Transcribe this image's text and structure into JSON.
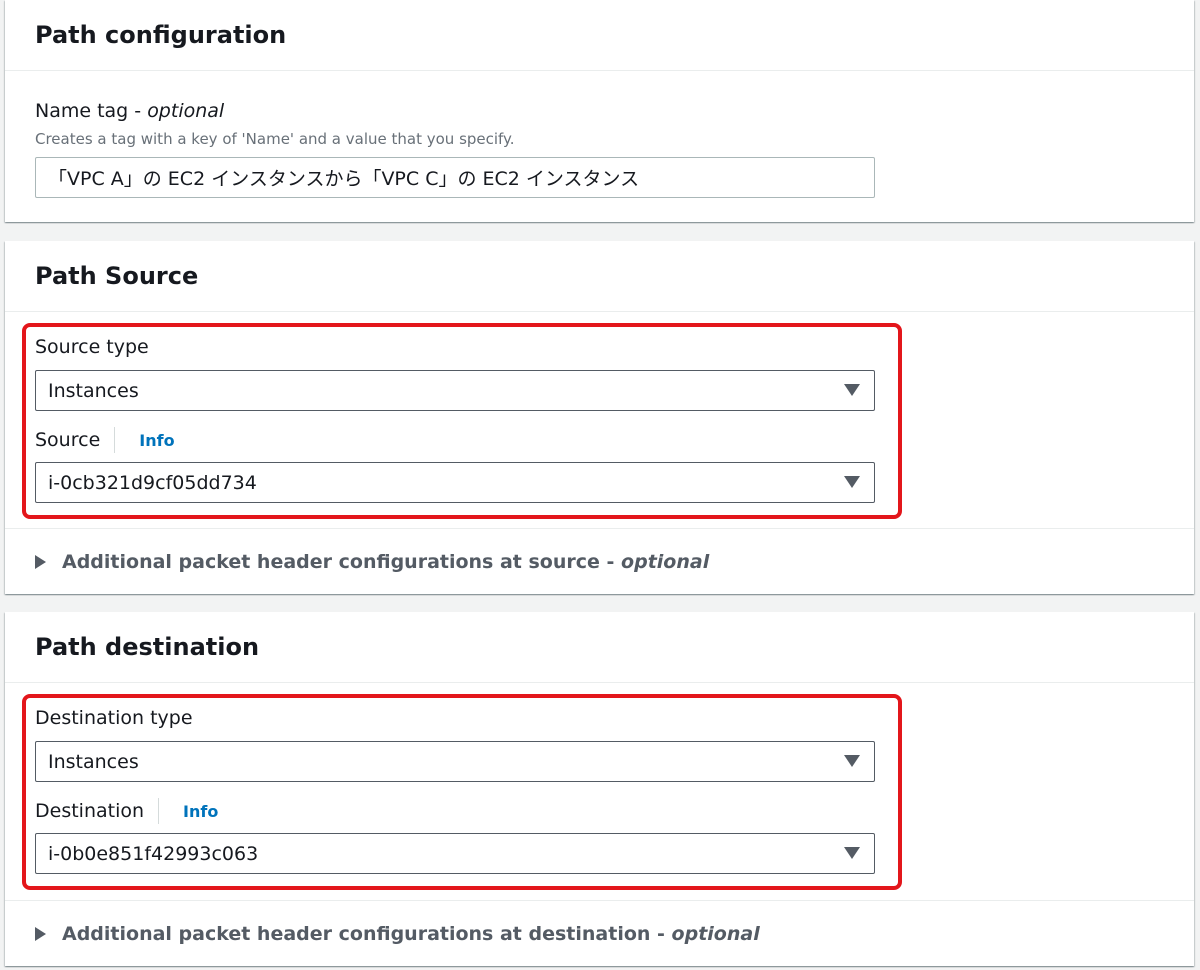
{
  "path_configuration": {
    "title": "Path configuration",
    "name_tag_label": "Name tag - ",
    "name_tag_optional": "optional",
    "name_tag_description": "Creates a tag with a key of 'Name' and a value that you specify.",
    "name_tag_value": "「VPC A」の EC2 インスタンスから「VPC C」の EC2 インスタンス"
  },
  "path_source": {
    "title": "Path Source",
    "source_type_label": "Source type",
    "source_type_value": "Instances",
    "source_label": "Source",
    "info_label": "Info",
    "source_value": "i-0cb321d9cf05dd734",
    "additional_label": "Additional packet header configurations at source - ",
    "additional_optional": "optional"
  },
  "path_destination": {
    "title": "Path destination",
    "destination_type_label": "Destination type",
    "destination_type_value": "Instances",
    "destination_label": "Destination",
    "info_label": "Info",
    "destination_value": "i-0b0e851f42993c063",
    "additional_label": "Additional packet header configurations at destination - ",
    "additional_optional": "optional"
  },
  "colors": {
    "highlight": "#e3161b",
    "link": "#0073bb",
    "background": "#f2f3f3"
  }
}
